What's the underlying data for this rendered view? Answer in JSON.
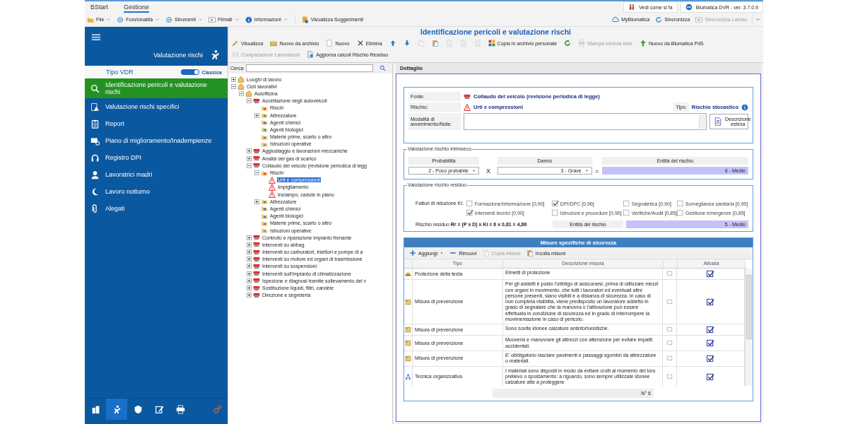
{
  "app_tabs": [
    {
      "label": "BStart",
      "selected": false
    },
    {
      "label": "Gestione",
      "selected": true
    }
  ],
  "top_buttons": [
    "Vedi come si fa",
    "Blumatica DVR - ver. 3.7.0.9"
  ],
  "menu": [
    {
      "label": "File",
      "dropdown": true
    },
    {
      "label": "Funzionalità",
      "dropdown": true
    },
    {
      "label": "Strumenti",
      "dropdown": true
    },
    {
      "label": "Filmati",
      "dropdown": true
    },
    {
      "label": "Informazioni",
      "dropdown": true
    },
    {
      "label": "Visualizza Suggerimenti",
      "dropdown": false
    }
  ],
  "sync_actions": [
    {
      "label": "MyBlumatica",
      "disabled": false
    },
    {
      "label": "Sincronizza",
      "disabled": false
    },
    {
      "label": "Sincronizza Lavoro",
      "disabled": true
    }
  ],
  "sidebar": {
    "title": "Valutazione rischi",
    "mode_label": "Tipo VDR",
    "mode_switch": {
      "label": "Classica",
      "on": true
    },
    "items": [
      {
        "label": "Identificazione pericoli e valutazione rischi",
        "selected": true
      },
      {
        "label": "Valutazione rischi specifici",
        "selected": false
      },
      {
        "label": "Report",
        "selected": false
      },
      {
        "label": "Piano di miglioramento/Inadempienze",
        "selected": false
      },
      {
        "label": "Registro DPI",
        "selected": false
      },
      {
        "label": "Lavoratrici madri",
        "selected": false
      },
      {
        "label": "Lavoro notturno",
        "selected": false
      },
      {
        "label": "Alegati",
        "selected": false
      }
    ],
    "bottom_tabs": [
      {
        "selected": false
      },
      {
        "selected": true
      },
      {
        "selected": false
      },
      {
        "selected": false
      },
      {
        "selected": false
      },
      {
        "selected": false
      }
    ]
  },
  "page_title": "Identificazione pericoli e valutazione rischi",
  "actions": [
    [
      {
        "label": "Visualizza",
        "disabled": false
      },
      {
        "label": "Nuovo da archivio",
        "disabled": false
      },
      {
        "label": "Nuovo",
        "disabled": false
      },
      {
        "label": "Elimina",
        "disabled": false
      },
      {
        "disabled": false
      },
      {
        "disabled": false
      },
      {
        "disabled": true
      },
      {
        "disabled": false
      },
      {
        "disabled": true
      },
      {
        "disabled": true
      },
      {
        "disabled": true
      },
      {
        "label": "Copia in archivio personale",
        "disabled": false
      },
      {
        "disabled": false
      },
      {
        "label": "Stampa scheda fase",
        "disabled": true
      },
      {
        "label": "Nuovo da Blumatica PdS",
        "disabled": false
      }
    ],
    [
      {
        "label": "Comparazione Lavorazioni",
        "disabled": true
      },
      {
        "label": "Aggiorna calcoli Rischio Residuo",
        "disabled": false
      }
    ]
  ],
  "tree": {
    "search_label": "Cerca",
    "nodes": [
      {
        "label": "Luoghi di lavoro",
        "kind": "place",
        "expanded": false,
        "selected": false
      },
      {
        "label": "Cicli lavorativi",
        "kind": "place",
        "expanded": true,
        "selected": false,
        "children": [
          {
            "label": "Autofficina",
            "kind": "house",
            "expanded": true,
            "selected": false,
            "children": [
              {
                "label": "Accettazione degli autoveicoli",
                "kind": "process",
                "expanded": true,
                "selected": false,
                "children": [
                  {
                    "label": "Rischi",
                    "kind": "risks",
                    "selected": false
                  },
                  {
                    "label": "Attrezzature",
                    "kind": "tools",
                    "expanded": false,
                    "selected": false
                  },
                  {
                    "label": "Agenti chimici",
                    "kind": "chemical",
                    "selected": false
                  },
                  {
                    "label": "Agenti biologici",
                    "kind": "biological",
                    "selected": false
                  },
                  {
                    "label": "Materie prime, scarto o altro",
                    "kind": "materials",
                    "selected": false
                  },
                  {
                    "label": "Istruzioni operative",
                    "kind": "instructions",
                    "selected": false
                  }
                ]
              },
              {
                "label": "Aggiustaggio e lavorazioni meccaniche",
                "kind": "process",
                "expanded": false,
                "selected": false
              },
              {
                "label": "Analisi dei gas di scarico",
                "kind": "process",
                "expanded": false,
                "selected": false
              },
              {
                "label": "Collaudo del veicolo (revisione periodica di legg",
                "kind": "process",
                "expanded": true,
                "selected": false,
                "children": [
                  {
                    "label": "Rischi",
                    "kind": "risks",
                    "expanded": true,
                    "selected": false,
                    "children": [
                      {
                        "label": "Urti e compressioni",
                        "kind": "risk",
                        "selected": true
                      },
                      {
                        "label": "Impigliamento",
                        "kind": "risk",
                        "selected": false
                      },
                      {
                        "label": "Inciampo, cadute in piano",
                        "kind": "risk",
                        "selected": false
                      }
                    ]
                  },
                  {
                    "label": "Attrezzature",
                    "kind": "tools",
                    "expanded": false,
                    "selected": false
                  },
                  {
                    "label": "Agenti chimici",
                    "kind": "chemical",
                    "selected": false
                  },
                  {
                    "label": "Agenti biologici",
                    "kind": "biological",
                    "selected": false
                  },
                  {
                    "label": "Materie prime, scarto o altro",
                    "kind": "materials",
                    "selected": false
                  },
                  {
                    "label": "Istruzioni operative",
                    "kind": "instructions",
                    "selected": false
                  }
                ]
              },
              {
                "label": "Controllo e riparazione impianto frenante",
                "kind": "process",
                "expanded": false,
                "selected": false
              },
              {
                "label": "Interventi su airbag",
                "kind": "process",
                "expanded": false,
                "selected": false
              },
              {
                "label": "Interventi su carburatori, iniettori e pompe di a",
                "kind": "process",
                "expanded": false,
                "selected": false
              },
              {
                "label": "Interventi su motore ed organi di trasmissione",
                "kind": "process",
                "expanded": false,
                "selected": false
              },
              {
                "label": "Interventi su sospensioni",
                "kind": "process",
                "expanded": false,
                "selected": false
              },
              {
                "label": "Interventi sull'impianto di climatizzazione",
                "kind": "process",
                "expanded": false,
                "selected": false
              },
              {
                "label": "Ispezione e diagnosi tramite sollevamento del v",
                "kind": "process",
                "expanded": false,
                "selected": false
              },
              {
                "label": "Sostituzione liquidi, filtri, candele",
                "kind": "process",
                "expanded": false,
                "selected": false
              },
              {
                "label": "Direzione e segreteria",
                "kind": "process",
                "expanded": false,
                "selected": false
              }
            ]
          }
        ]
      }
    ]
  },
  "detail": {
    "header": "Dettaglio",
    "fonte_label": "Fonte:",
    "fonte": "Collaudo del veicolo (revisione periodica di legge)",
    "rischio_label": "Rischio:",
    "rischio": "Urti e compressioni",
    "tipo_label": "Tipo:",
    "tipo": "Rischio stocastico",
    "note_label": "Modalità di avvenimento/Note:",
    "note_button": "Descrizione estesa",
    "intrinsic": {
      "legend": "Valutazione rischio intrinseco",
      "probability_label": "Probabilità",
      "probability": "2 - Poco probabile",
      "times": "X",
      "damage_label": "Danno",
      "damage": "3 - Grave",
      "equals": "=",
      "entity_label": "Entità del rischio",
      "entity": "6 - Medio"
    },
    "residual": {
      "legend": "Valutazione rischio residuo",
      "factors_label": "Fattori di riduzione Ki:",
      "factors": [
        {
          "label": "Formazione/Informazione [0,90]",
          "checked": false
        },
        {
          "label": "DPI/DPC [0,90]",
          "checked": true
        },
        {
          "label": "Segnaletica [0,90]",
          "checked": false
        },
        {
          "label": "Sorveglianza sanitaria [0,90]",
          "checked": false
        },
        {
          "label": "Interventi tecnici [0,90]",
          "checked": true
        },
        {
          "label": "Istruzioni e procedure [0,90]",
          "checked": false
        },
        {
          "label": "Verifiche/Audit [0,85]",
          "checked": false
        },
        {
          "label": "Gestione emergenze [0,85]",
          "checked": false
        }
      ],
      "formula": "Rischio residuo **Rr = (P x D) x Ki = 6 x 0,81 = 4,86**",
      "entity_label": "Entità del rischio",
      "entity": "5 - Medio"
    },
    "measures": {
      "title": "Misure specifiche di sicurezza",
      "tools": [
        {
          "label": "Aggiungi",
          "dropdown": true,
          "disabled": false
        },
        {
          "label": "Rimuovi",
          "dropdown": false,
          "disabled": false
        },
        {
          "label": "Copia misure",
          "dropdown": false,
          "disabled": true
        },
        {
          "label": "Incolla misure",
          "dropdown": false,
          "disabled": false
        }
      ],
      "columns": [
        "Tipo",
        "Descrizione misura",
        "Attuata"
      ],
      "rows": [
        {
          "kind": "helmet",
          "type": "Protezione della testa",
          "description": "Elmetti di protezione",
          "applied": true
        },
        {
          "kind": "prevention",
          "type": "Misura di prevenzione",
          "description": "Per gli addetti è posto l'obbligo di assicurarsi, prima di utilizzare mezzi con organi in movimento, che tutti i lavoratori ed eventuali altre persone presenti, siano visibili e a distanza di sicurezza. In caso di non completa visibilità, viene predisposto un lavoratore addetto in grado di segnalare che la manovra o l'attivazione può essere effettuata in condizione di sicurezza ed in grado di interrompere la movimentazione in caso di pericolo.",
          "applied": true
        },
        {
          "kind": "prevention",
          "type": "Misura di prevenzione",
          "description": "Sono scelte idonee calzature antinfortunistiche.",
          "applied": true
        },
        {
          "kind": "prevention",
          "type": "Misura di prevenzione",
          "description": "Muoversi e manovrare gli attrezzi con attenzione per evitare impatti accidentali.",
          "applied": true
        },
        {
          "kind": "prevention",
          "type": "Misura di prevenzione",
          "description": "E' obbligatorio lasciare pavimenti e passaggi sgombri da attrezzature o materiali.",
          "applied": true
        },
        {
          "kind": "organizational",
          "type": "Tecnica organizzativa",
          "description": "I materiali sono disposti in modo da evitare crolli al momento del loro prelievo o spostamento: a riguardo, sono sempre utilizzate idonee calzature atte a proteggere",
          "applied": true
        }
      ],
      "count": "N° 6"
    }
  }
}
